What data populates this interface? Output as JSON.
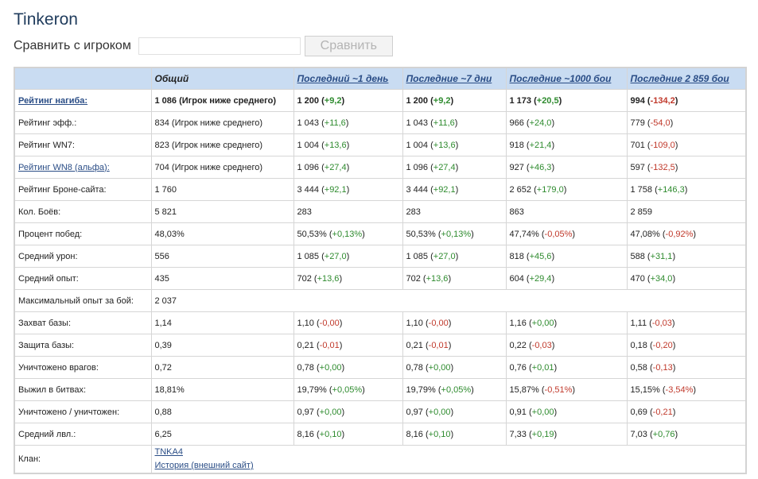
{
  "player": {
    "name": "Tinkeron"
  },
  "compare": {
    "label": "Сравнить с игроком",
    "input_value": "",
    "button_label": "Сравнить"
  },
  "table": {
    "headers": [
      "",
      "Общий",
      "Последний ~1 день",
      "Последние ~7 дни",
      "Последние ~1000 бои",
      "Последние 2 859 бои"
    ],
    "rows": [
      {
        "label": "Рейтинг нагиба:",
        "link": true,
        "bold": true,
        "cells": [
          {
            "v": "1 086 (Игрок ниже среднего)"
          },
          {
            "v": "1 200",
            "d": "+9,2",
            "s": "pos"
          },
          {
            "v": "1 200",
            "d": "+9,2",
            "s": "pos"
          },
          {
            "v": "1 173",
            "d": "+20,5",
            "s": "pos"
          },
          {
            "v": "994",
            "d": "-134,2",
            "s": "neg"
          }
        ]
      },
      {
        "label": "Рейтинг эфф.:",
        "cells": [
          {
            "v": "834 (Игрок ниже среднего)"
          },
          {
            "v": "1 043",
            "d": "+11,6",
            "s": "pos"
          },
          {
            "v": "1 043",
            "d": "+11,6",
            "s": "pos"
          },
          {
            "v": "966",
            "d": "+24,0",
            "s": "pos"
          },
          {
            "v": "779",
            "d": "-54,0",
            "s": "neg"
          }
        ]
      },
      {
        "label": "Рейтинг WN7:",
        "cells": [
          {
            "v": "823 (Игрок ниже среднего)"
          },
          {
            "v": "1 004",
            "d": "+13,6",
            "s": "pos"
          },
          {
            "v": "1 004",
            "d": "+13,6",
            "s": "pos"
          },
          {
            "v": "918",
            "d": "+21,4",
            "s": "pos"
          },
          {
            "v": "701",
            "d": "-109,0",
            "s": "neg"
          }
        ]
      },
      {
        "label": "Рейтинг WN8 (альфа):",
        "link": true,
        "cells": [
          {
            "v": "704 (Игрок ниже среднего)"
          },
          {
            "v": "1 096",
            "d": "+27,4",
            "s": "pos"
          },
          {
            "v": "1 096",
            "d": "+27,4",
            "s": "pos"
          },
          {
            "v": "927",
            "d": "+46,3",
            "s": "pos"
          },
          {
            "v": "597",
            "d": "-132,5",
            "s": "neg"
          }
        ]
      },
      {
        "label": "Рейтинг Броне-сайта:",
        "cells": [
          {
            "v": "1 760"
          },
          {
            "v": "3 444",
            "d": "+92,1",
            "s": "pos"
          },
          {
            "v": "3 444",
            "d": "+92,1",
            "s": "pos"
          },
          {
            "v": "2 652",
            "d": "+179,0",
            "s": "pos"
          },
          {
            "v": "1 758",
            "d": "+146,3",
            "s": "pos"
          }
        ]
      },
      {
        "label": "Кол. Боёв:",
        "cells": [
          {
            "v": "5 821"
          },
          {
            "v": "283"
          },
          {
            "v": "283"
          },
          {
            "v": "863"
          },
          {
            "v": "2 859"
          }
        ]
      },
      {
        "label": "Процент побед:",
        "cells": [
          {
            "v": "48,03%"
          },
          {
            "v": "50,53%",
            "d": "+0,13%",
            "s": "pos"
          },
          {
            "v": "50,53%",
            "d": "+0,13%",
            "s": "pos"
          },
          {
            "v": "47,74%",
            "d": "-0,05%",
            "s": "neg"
          },
          {
            "v": "47,08%",
            "d": "-0,92%",
            "s": "neg"
          }
        ]
      },
      {
        "label": "Средний урон:",
        "cells": [
          {
            "v": "556"
          },
          {
            "v": "1 085",
            "d": "+27,0",
            "s": "pos"
          },
          {
            "v": "1 085",
            "d": "+27,0",
            "s": "pos"
          },
          {
            "v": "818",
            "d": "+45,6",
            "s": "pos"
          },
          {
            "v": "588",
            "d": "+31,1",
            "s": "pos"
          }
        ]
      },
      {
        "label": "Средний опыт:",
        "cells": [
          {
            "v": "435"
          },
          {
            "v": "702",
            "d": "+13,6",
            "s": "pos"
          },
          {
            "v": "702",
            "d": "+13,6",
            "s": "pos"
          },
          {
            "v": "604",
            "d": "+29,4",
            "s": "pos"
          },
          {
            "v": "470",
            "d": "+34,0",
            "s": "pos"
          }
        ]
      },
      {
        "label": "Максимальный опыт за бой:",
        "span": true,
        "cells": [
          {
            "v": "2 037"
          }
        ]
      },
      {
        "label": "Захват базы:",
        "cells": [
          {
            "v": "1,14"
          },
          {
            "v": "1,10",
            "d": "-0,00",
            "s": "neg"
          },
          {
            "v": "1,10",
            "d": "-0,00",
            "s": "neg"
          },
          {
            "v": "1,16",
            "d": "+0,00",
            "s": "pos"
          },
          {
            "v": "1,11",
            "d": "-0,03",
            "s": "neg"
          }
        ]
      },
      {
        "label": "Защита базы:",
        "cells": [
          {
            "v": "0,39"
          },
          {
            "v": "0,21",
            "d": "-0,01",
            "s": "neg"
          },
          {
            "v": "0,21",
            "d": "-0,01",
            "s": "neg"
          },
          {
            "v": "0,22",
            "d": "-0,03",
            "s": "neg"
          },
          {
            "v": "0,18",
            "d": "-0,20",
            "s": "neg"
          }
        ]
      },
      {
        "label": "Уничтожено врагов:",
        "cells": [
          {
            "v": "0,72"
          },
          {
            "v": "0,78",
            "d": "+0,00",
            "s": "pos"
          },
          {
            "v": "0,78",
            "d": "+0,00",
            "s": "pos"
          },
          {
            "v": "0,76",
            "d": "+0,01",
            "s": "pos"
          },
          {
            "v": "0,58",
            "d": "-0,13",
            "s": "neg"
          }
        ]
      },
      {
        "label": "Выжил в битвах:",
        "cells": [
          {
            "v": "18,81%"
          },
          {
            "v": "19,79%",
            "d": "+0,05%",
            "s": "pos"
          },
          {
            "v": "19,79%",
            "d": "+0,05%",
            "s": "pos"
          },
          {
            "v": "15,87%",
            "d": "-0,51%",
            "s": "neg"
          },
          {
            "v": "15,15%",
            "d": "-3,54%",
            "s": "neg"
          }
        ]
      },
      {
        "label": "Уничтожено / уничтожен:",
        "cells": [
          {
            "v": "0,88"
          },
          {
            "v": "0,97",
            "d": "+0,00",
            "s": "pos"
          },
          {
            "v": "0,97",
            "d": "+0,00",
            "s": "pos"
          },
          {
            "v": "0,91",
            "d": "+0,00",
            "s": "pos"
          },
          {
            "v": "0,69",
            "d": "-0,21",
            "s": "neg"
          }
        ]
      },
      {
        "label": "Средний лвл.:",
        "cells": [
          {
            "v": "6,25"
          },
          {
            "v": "8,16",
            "d": "+0,10",
            "s": "pos"
          },
          {
            "v": "8,16",
            "d": "+0,10",
            "s": "pos"
          },
          {
            "v": "7,33",
            "d": "+0,19",
            "s": "pos"
          },
          {
            "v": "7,03",
            "d": "+0,76",
            "s": "pos"
          }
        ]
      }
    ],
    "clan": {
      "label": "Клан:",
      "name": "TNKA4",
      "history_link": "История (внешний сайт)"
    }
  },
  "colors": {
    "positive": "#2e8b2e",
    "negative": "#c0392b",
    "header_bg": "#c9dcf2",
    "link": "#2a4d86"
  }
}
